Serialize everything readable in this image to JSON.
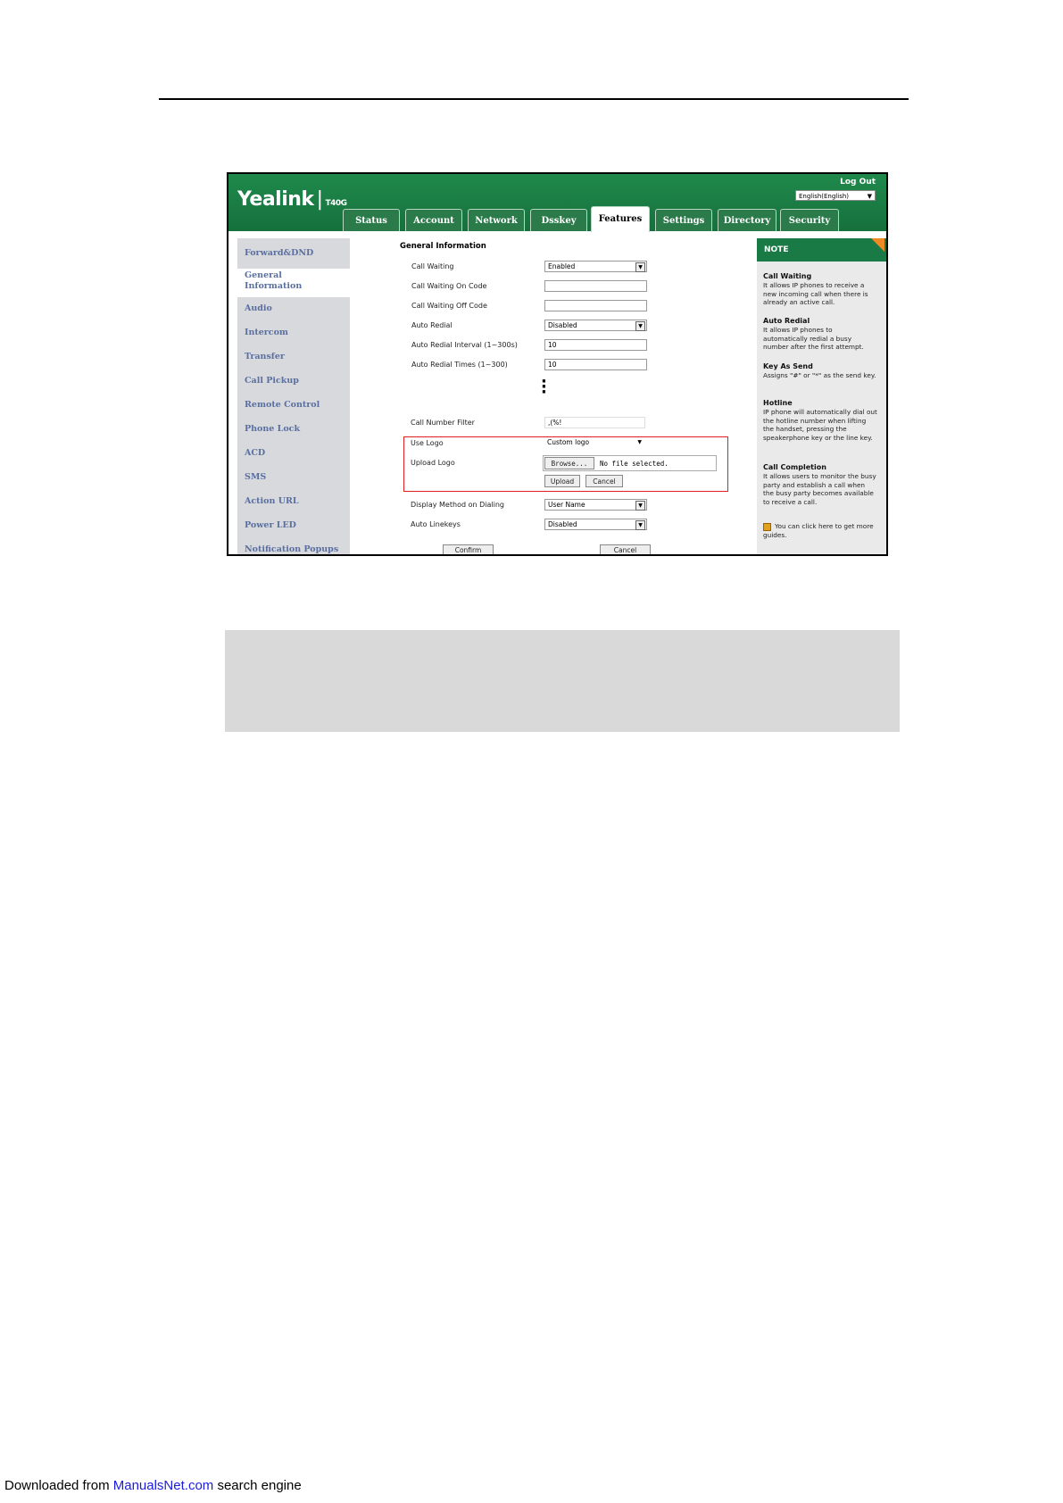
{
  "app": {
    "brand": "Yealink",
    "model": "T40G",
    "logout": "Log Out",
    "language": "English(English)"
  },
  "tabs": [
    "Status",
    "Account",
    "Network",
    "Dsskey",
    "Features",
    "Settings",
    "Directory",
    "Security"
  ],
  "active_tab": "Features",
  "nav": [
    "Forward&DND",
    "General Information",
    "Audio",
    "Intercom",
    "Transfer",
    "Call Pickup",
    "Remote Control",
    "Phone Lock",
    "ACD",
    "SMS",
    "Action URL",
    "Power LED",
    "Notification Popups"
  ],
  "form": {
    "section_title": "General Information",
    "call_waiting": {
      "label": "Call Waiting",
      "value": "Enabled"
    },
    "call_waiting_on_code": {
      "label": "Call Waiting On Code",
      "value": ""
    },
    "call_waiting_off_code": {
      "label": "Call Waiting Off Code",
      "value": ""
    },
    "auto_redial": {
      "label": "Auto Redial",
      "value": "Disabled"
    },
    "auto_redial_interval": {
      "label": "Auto Redial Interval (1~300s)",
      "value": "10"
    },
    "auto_redial_times": {
      "label": "Auto Redial Times (1~300)",
      "value": "10"
    },
    "call_number_filter": {
      "label": "Call Number Filter",
      "value": ",(%!"
    },
    "use_logo": {
      "label": "Use Logo",
      "value": "Custom logo"
    },
    "upload_logo": {
      "label": "Upload Logo",
      "browse": "Browse...",
      "no_file": "No file selected.",
      "upload": "Upload",
      "cancel": "Cancel"
    },
    "display_method": {
      "label": "Display Method on Dialing",
      "value": "User Name"
    },
    "auto_linekeys": {
      "label": "Auto Linekeys",
      "value": "Disabled"
    },
    "confirm": "Confirm",
    "cancel": "Cancel"
  },
  "note": {
    "header": "NOTE",
    "items": [
      {
        "title": "Call Waiting",
        "body": "It allows IP phones to receive a new incoming call when there is already an active call."
      },
      {
        "title": "Auto Redial",
        "body": "It allows IP phones to automatically redial a busy number after the first attempt."
      },
      {
        "title": "Key As Send",
        "body": "Assigns \"#\" or \"*\" as the send key."
      },
      {
        "title": "Hotline",
        "body": "IP phone will automatically dial out the hotline number when lifting the handset, pressing the speakerphone key or the line key."
      },
      {
        "title": "Call Completion",
        "body": "It allows users to monitor the busy party and establish a call when the busy party becomes available to receive a call."
      }
    ],
    "guide": "You can click here to get more guides."
  },
  "footer": {
    "prefix": "Downloaded from ",
    "link": "ManualsNet.com",
    "suffix": " search engine"
  }
}
